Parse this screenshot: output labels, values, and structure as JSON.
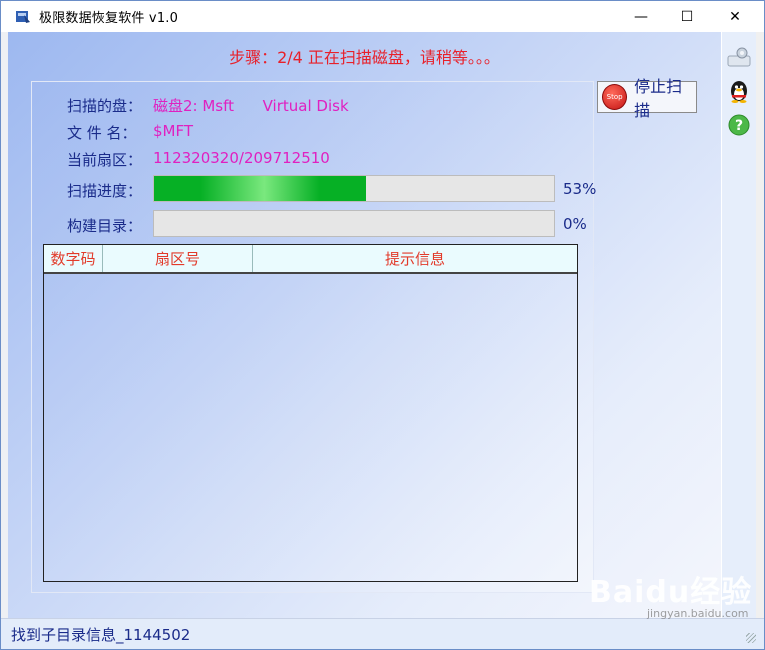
{
  "window": {
    "title": "极限数据恢复软件 v1.0",
    "minimize_glyph": "—",
    "maximize_glyph": "☐",
    "close_glyph": "✕"
  },
  "step": {
    "text": "步骤：2/4 正在扫描磁盘，请稍等。。。"
  },
  "fields": {
    "disk_label": "扫描的盘：",
    "disk_value": "磁盘2: Msft      Virtual Disk",
    "file_label": "文 件 名：",
    "file_value": "$MFT",
    "sector_label": "当前扇区：",
    "sector_value": "112320320/209712510"
  },
  "progress": {
    "scan_label": "扫描进度：",
    "scan_fraction": 0.53,
    "scan_pct_text": "53%",
    "build_label": "构建目录：",
    "build_fraction": 0.0,
    "build_pct_text": "0%"
  },
  "list": {
    "columns": [
      "数字码",
      "扇区号",
      "提示信息"
    ],
    "rows": []
  },
  "buttons": {
    "stop_label": "停止扫描",
    "stop_icon_text": "Stop"
  },
  "side_icons": [
    "settings-gear-icon",
    "qq-penguin-icon",
    "help-question-icon"
  ],
  "status": {
    "text": "找到子目录信息_1144502"
  },
  "watermark": {
    "logo": "Baidu经验",
    "url": "jingyan.baidu.com"
  },
  "colors": {
    "title_red": "#e8202a",
    "label_blue": "#1a2b8a",
    "value_magenta": "#e020c0",
    "progress_green": "#06b025",
    "column_red": "#e23a2a"
  }
}
